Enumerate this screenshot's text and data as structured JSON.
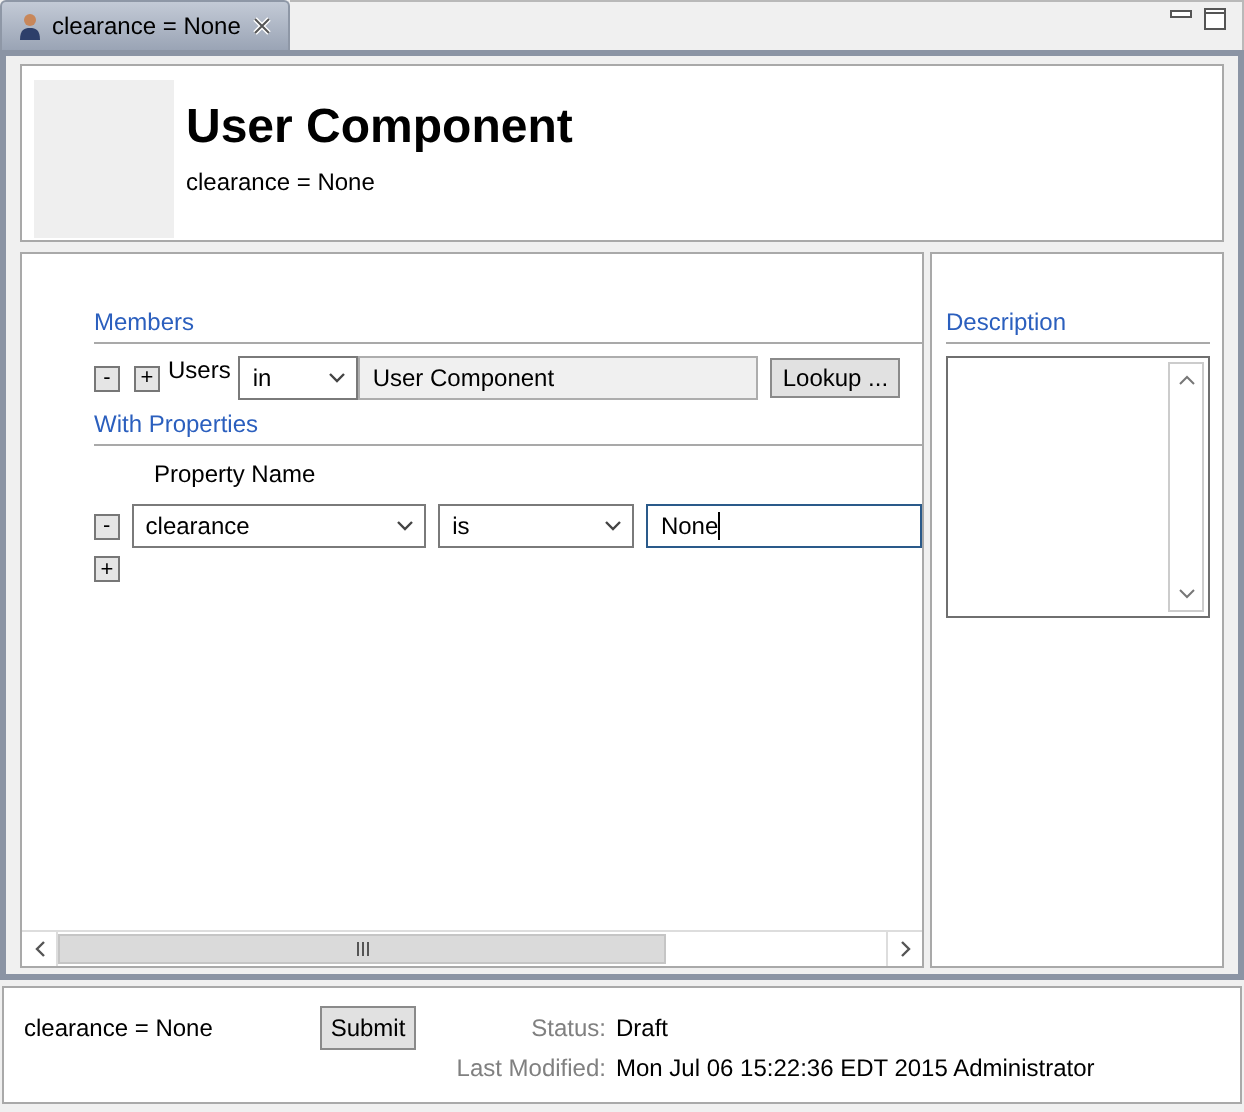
{
  "tab": {
    "title": "clearance = None",
    "selected": true
  },
  "header": {
    "title": "User Component",
    "subtitle": "clearance = None"
  },
  "members": {
    "heading": "Members",
    "remove": "-",
    "add": "+",
    "label": "Users",
    "operator": "in",
    "value": "User Component",
    "lookup": "Lookup ..."
  },
  "properties": {
    "heading": "With Properties",
    "column": "Property Name",
    "rows": [
      {
        "remove": "-",
        "name": "clearance",
        "operator": "is",
        "value": "None",
        "focused": true
      }
    ],
    "add": "+"
  },
  "description": {
    "heading": "Description"
  },
  "footer": {
    "summary": "clearance = None",
    "submit": "Submit",
    "status_label": "Status:",
    "status": "Draft",
    "modified_label": "Last Modified:",
    "modified": "Mon Jul 06 15:22:36 EDT 2015 Administrator"
  }
}
